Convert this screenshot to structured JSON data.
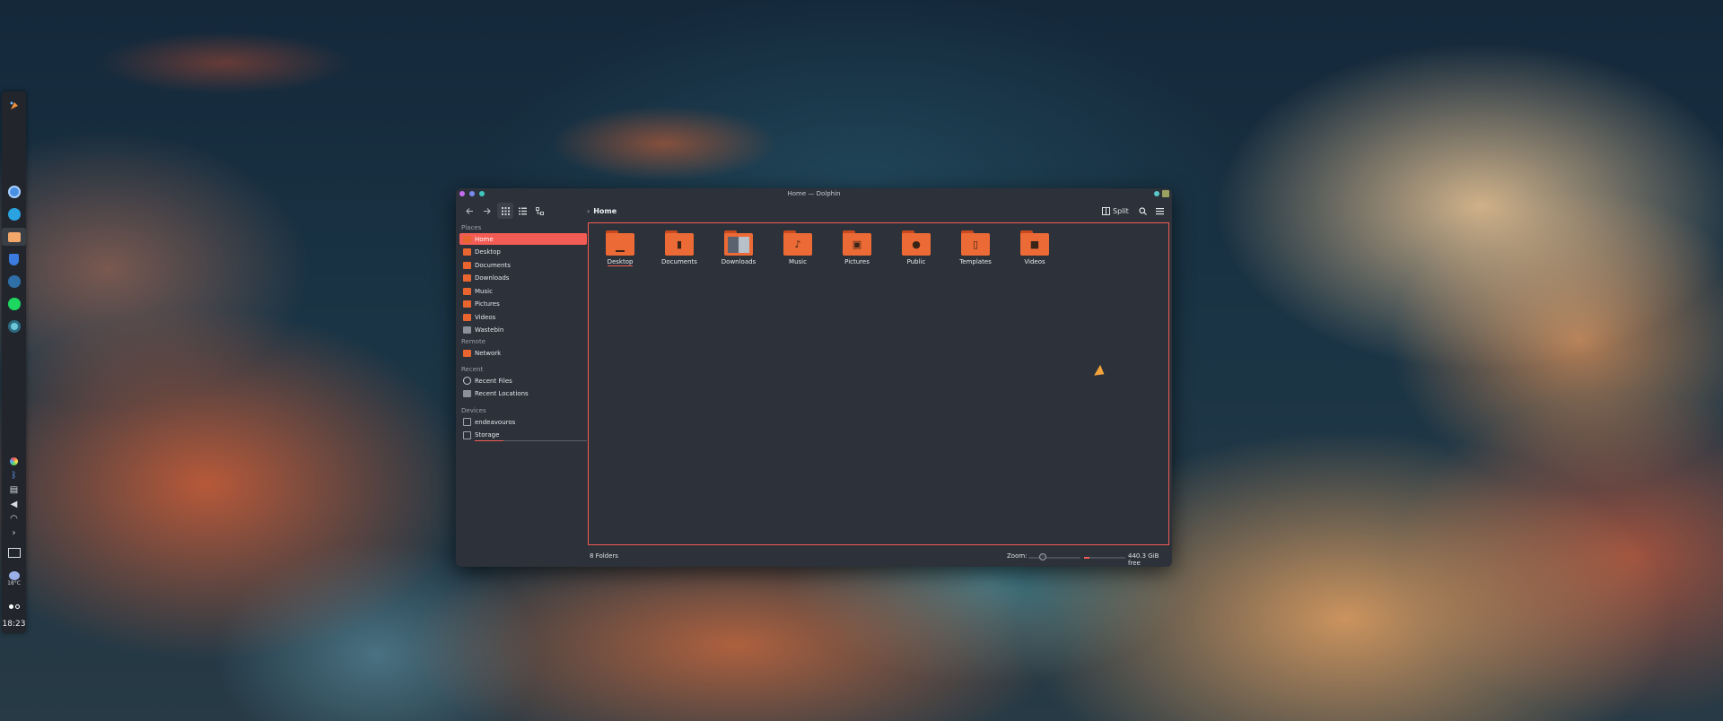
{
  "window": {
    "title": "Home — Dolphin"
  },
  "toolbar": {
    "back_icon": "arrow-left-icon",
    "forward_icon": "arrow-right-icon",
    "breadcrumb": "Home",
    "split_label": "Split"
  },
  "sidebar": {
    "places_heading": "Places",
    "places": [
      "Home",
      "Desktop",
      "Documents",
      "Downloads",
      "Music",
      "Pictures",
      "Videos",
      "Wastebin"
    ],
    "remote_heading": "Remote",
    "remote": [
      "Network"
    ],
    "recent_heading": "Recent",
    "recent": [
      "Recent Files",
      "Recent Locations"
    ],
    "devices_heading": "Devices",
    "devices": [
      "endeavouros",
      "Storage"
    ]
  },
  "files": [
    {
      "name": "Desktop",
      "icon": "monitor-icon"
    },
    {
      "name": "Documents",
      "icon": "document-icon"
    },
    {
      "name": "Downloads",
      "icon": "download-icon"
    },
    {
      "name": "Music",
      "icon": "music-note-icon"
    },
    {
      "name": "Pictures",
      "icon": "image-icon"
    },
    {
      "name": "Public",
      "icon": "user-icon"
    },
    {
      "name": "Templates",
      "icon": "template-icon"
    },
    {
      "name": "Videos",
      "icon": "video-camera-icon"
    }
  ],
  "status": {
    "count": "8 Folders",
    "zoom_label": "Zoom:",
    "free_space": "440.3 GiB free"
  },
  "dock": {
    "clock": "18:23",
    "temperature": "18°C"
  },
  "colors": {
    "accent": "#f25c54",
    "folder": "#ec6a35",
    "window_bg": "#2c313a"
  }
}
